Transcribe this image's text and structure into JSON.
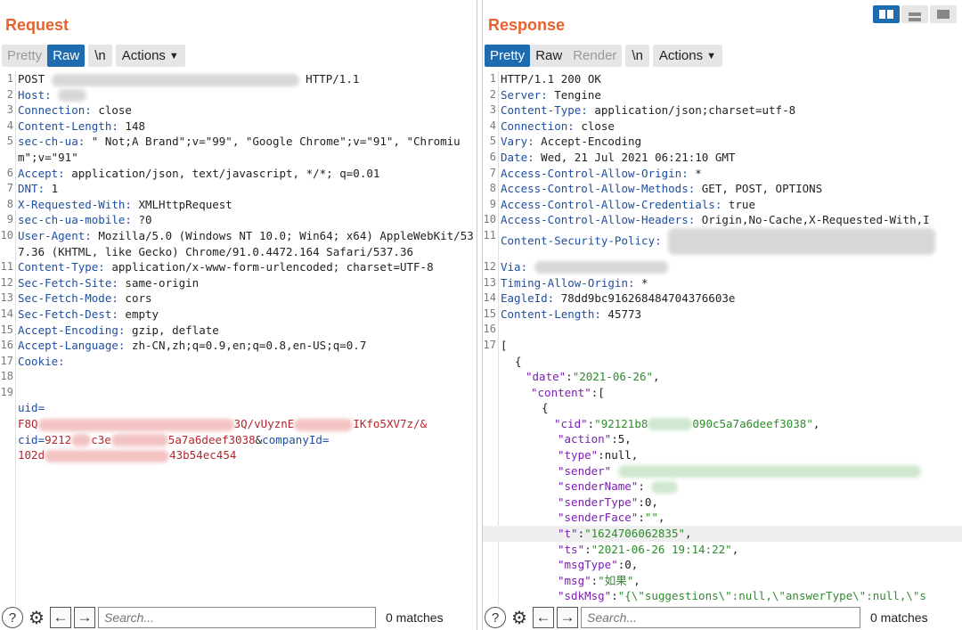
{
  "request": {
    "title": "Request",
    "tabs": [
      "Pretty",
      "Raw"
    ],
    "active_tab": "Raw",
    "newline_toggle": "\\n",
    "actions_label": "Actions",
    "search_placeholder": "Search...",
    "matches": "0 matches",
    "lines": [
      {
        "n": "1",
        "k": "",
        "v": "POST "
      },
      {
        "n": "1b",
        "k": "",
        "v": "HTTP/1.1"
      },
      {
        "n": "2",
        "k": "Host:",
        "v": ""
      },
      {
        "n": "3",
        "k": "Connection:",
        "v": " close"
      },
      {
        "n": "4",
        "k": "Content-Length:",
        "v": " 148"
      },
      {
        "n": "5",
        "k": "sec-ch-ua:",
        "v": " \" Not;A Brand\";v=\"99\", \"Google Chrome\";v=\"91\", \"Chromium\";v=\"91\""
      },
      {
        "n": "6",
        "k": "Accept:",
        "v": " application/json, text/javascript, */*; q=0.01"
      },
      {
        "n": "7",
        "k": "DNT:",
        "v": " 1"
      },
      {
        "n": "8",
        "k": "X-Requested-With:",
        "v": " XMLHttpRequest"
      },
      {
        "n": "9",
        "k": "sec-ch-ua-mobile:",
        "v": " ?0"
      },
      {
        "n": "10",
        "k": "User-Agent:",
        "v": " Mozilla/5.0 (Windows NT 10.0; Win64; x64) AppleWebKit/537.36 (KHTML, like Gecko) Chrome/91.0.4472.164 Safari/537.36"
      },
      {
        "n": "11",
        "k": "Content-Type:",
        "v": " application/x-www-form-urlencoded; charset=UTF-8"
      },
      {
        "n": "12",
        "k": "Sec-Fetch-Site:",
        "v": " same-origin"
      },
      {
        "n": "13",
        "k": "Sec-Fetch-Mode:",
        "v": " cors"
      },
      {
        "n": "14",
        "k": "Sec-Fetch-Dest:",
        "v": " empty"
      },
      {
        "n": "15",
        "k": "Accept-Encoding:",
        "v": " gzip, deflate"
      },
      {
        "n": "16",
        "k": "Accept-Language:",
        "v": " zh-CN,zh;q=0.9,en;q=0.8,en-US;q=0.7"
      },
      {
        "n": "17",
        "k": "Cookie:",
        "v": ""
      },
      {
        "n": "18",
        "k": "",
        "v": ""
      }
    ],
    "body_line_number": "19",
    "body": {
      "uid_key": "uid=",
      "uid_start": "F8Q",
      "uid_mid": "3Q/vUyznE",
      "uid_end": "IKfo5XV7z/&",
      "cid_key": "cid=",
      "cid_start": "9212",
      "cid_mid": "c3e",
      "cid_end": "5a7a6deef3038",
      "amp": "&",
      "company_key": "companyId=",
      "company_start": "102d",
      "company_end": "43b54ec454"
    }
  },
  "response": {
    "title": "Response",
    "tabs": [
      "Pretty",
      "Raw",
      "Render"
    ],
    "active_tab": "Pretty",
    "newline_toggle": "\\n",
    "actions_label": "Actions",
    "search_placeholder": "Search...",
    "matches": "0 matches",
    "header_lines": [
      {
        "n": "1",
        "k": "",
        "v": "HTTP/1.1 200 OK"
      },
      {
        "n": "2",
        "k": "Server:",
        "v": " Tengine"
      },
      {
        "n": "3",
        "k": "Content-Type:",
        "v": " application/json;charset=utf-8"
      },
      {
        "n": "4",
        "k": "Connection:",
        "v": " close"
      },
      {
        "n": "5",
        "k": "Vary:",
        "v": " Accept-Encoding"
      },
      {
        "n": "6",
        "k": "Date:",
        "v": " Wed, 21 Jul 2021 06:21:10 GMT"
      },
      {
        "n": "7",
        "k": "Access-Control-Allow-Origin:",
        "v": " *"
      },
      {
        "n": "8",
        "k": "Access-Control-Allow-Methods:",
        "v": " GET, POST, OPTIONS"
      },
      {
        "n": "9",
        "k": "Access-Control-Allow-Credentials:",
        "v": " true"
      },
      {
        "n": "10",
        "k": "Access-Control-Allow-Headers:",
        "v": " Origin,No-Cache,X-Requested-With,I"
      },
      {
        "n": "11",
        "k": "Content-Security-Policy:",
        "v": ""
      },
      {
        "n": "12",
        "k": "Via:",
        "v": ""
      },
      {
        "n": "13",
        "k": "Timing-Allow-Origin:",
        "v": " *"
      },
      {
        "n": "14",
        "k": "EagleId:",
        "v": " 78dd9bc916268484704376603e"
      },
      {
        "n": "15",
        "k": "Content-Length:",
        "v": " 45773"
      },
      {
        "n": "16",
        "k": "",
        "v": ""
      }
    ],
    "json_line_number": "17",
    "json": {
      "open_bracket": "[",
      "open_brace": "{",
      "date_key": "\"date\"",
      "date_val": "\"2021-06-26\"",
      "content_key": "\"content\"",
      "inner_brace": "{",
      "cid_key": "\"cid\"",
      "cid_start": "\"92121b8",
      "cid_end": "090c5a7a6deef3038\"",
      "action_key": "\"action\"",
      "action_val": "5",
      "type_key": "\"type\"",
      "type_val": "null",
      "sender_key": "\"sender\"",
      "senderName_key": "\"senderName\"",
      "senderType_key": "\"senderType\"",
      "senderType_val": "0",
      "senderFace_key": "\"senderFace\"",
      "senderFace_val": "\"\"",
      "t_key": "\"t\"",
      "t_val": "\"1624706062835\"",
      "ts_key": "\"ts\"",
      "ts_val": "\"2021-06-26 19:14:22\"",
      "msgType_key": "\"msgType\"",
      "msgType_val": "0",
      "msg_key": "\"msg\"",
      "msg_val": "\"如果\"",
      "sdkMsg_key": "\"sdkMsg\"",
      "sdkMsg_val": "\"{\\\"suggestions\\\":null,\\\"answerType\\\":null,\\\"s"
    }
  },
  "colors": {
    "title": "#e8622e",
    "active_tab": "#1f6bb0",
    "header_key": "#1f4fa0",
    "json_key": "#7a1fb0",
    "json_string": "#2e8b2e",
    "body_red": "#b3262c"
  },
  "icons": [
    "help-icon",
    "settings-gear-icon",
    "arrow-left-icon",
    "arrow-right-icon",
    "view-split-icon",
    "view-horizontal-icon",
    "view-single-icon",
    "chevron-down-icon"
  ]
}
